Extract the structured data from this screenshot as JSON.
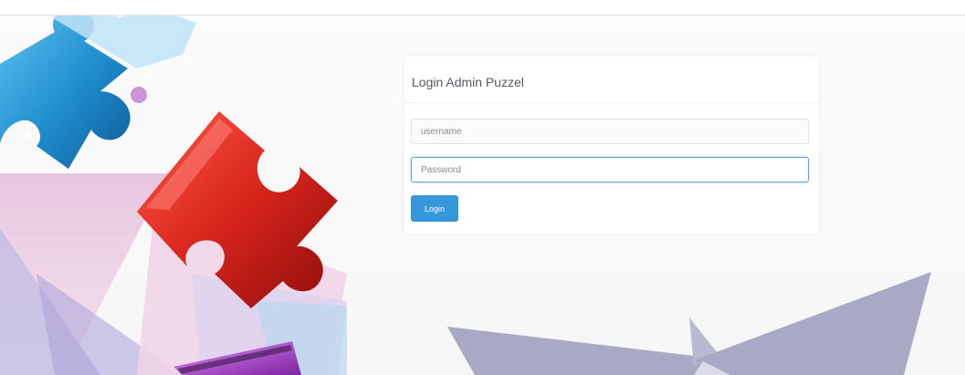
{
  "login": {
    "title": "Login Admin Puzzel",
    "username_placeholder": "username",
    "password_placeholder": "Password",
    "submit_label": "Login"
  },
  "colors": {
    "button": "#3598dc",
    "focus_border": "#6aa2c8",
    "puzzle_red": "#d7241c",
    "puzzle_blue": "#1f8ccd",
    "puzzle_purple": "#a33fc2",
    "shape_slate": "#a9a9c5"
  }
}
